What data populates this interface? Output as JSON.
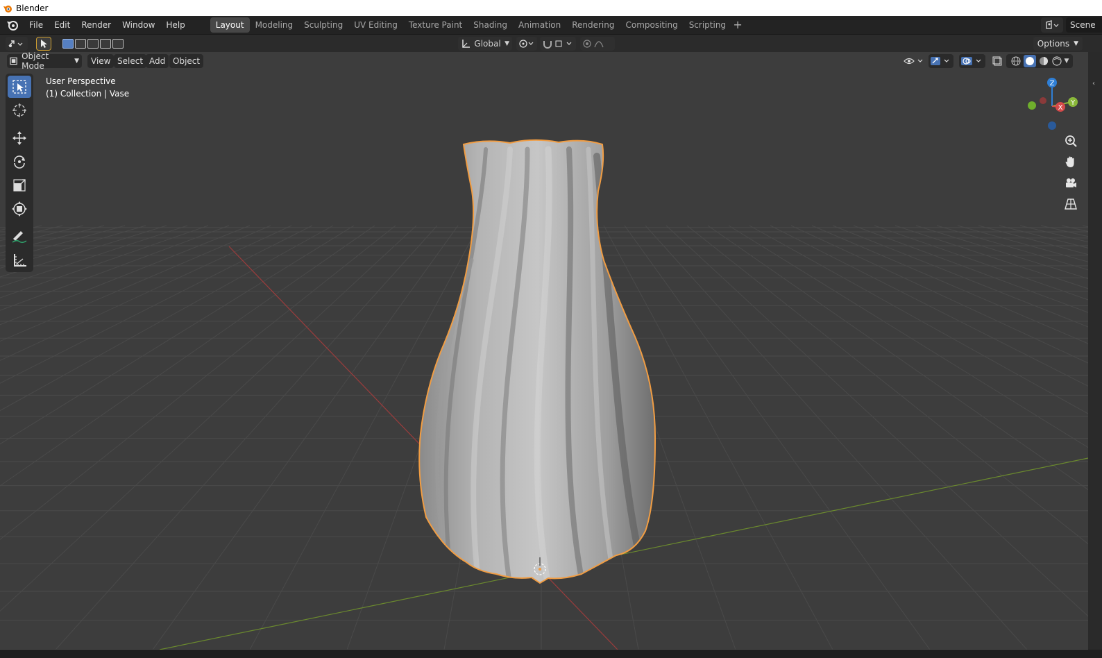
{
  "window": {
    "title": "Blender"
  },
  "menus": [
    "File",
    "Edit",
    "Render",
    "Window",
    "Help"
  ],
  "workspaces": [
    "Layout",
    "Modeling",
    "Sculpting",
    "UV Editing",
    "Texture Paint",
    "Shading",
    "Animation",
    "Rendering",
    "Compositing",
    "Scripting"
  ],
  "active_workspace": "Layout",
  "scene": {
    "name": "Scene"
  },
  "tool_header": {
    "transform_orientation": "Global",
    "options_label": "Options"
  },
  "viewport": {
    "mode": "Object Mode",
    "menus": [
      "View",
      "Select",
      "Add",
      "Object"
    ],
    "perspective_label": "User Perspective",
    "collection_label": "(1) Collection | Vase",
    "shading": "solid"
  },
  "gizmo": {
    "axes": [
      "Z",
      "X",
      "Y"
    ]
  },
  "colors": {
    "accent": "#4772b3",
    "selection_outline": "#f19d43",
    "x_axis": "#d44a4a",
    "y_axis": "#8ab83a",
    "z_axis": "#2f7fd6",
    "viewport_bg": "#3d3d3d"
  },
  "icons": [
    "blender-logo-icon",
    "editor-type-icon",
    "select-box-icon",
    "cursor-icon",
    "move-icon",
    "rotate-icon",
    "scale-icon",
    "transform-icon",
    "annotate-icon",
    "measure-icon",
    "zoom-icon",
    "pan-icon",
    "camera-icon",
    "grid-view-icon"
  ]
}
